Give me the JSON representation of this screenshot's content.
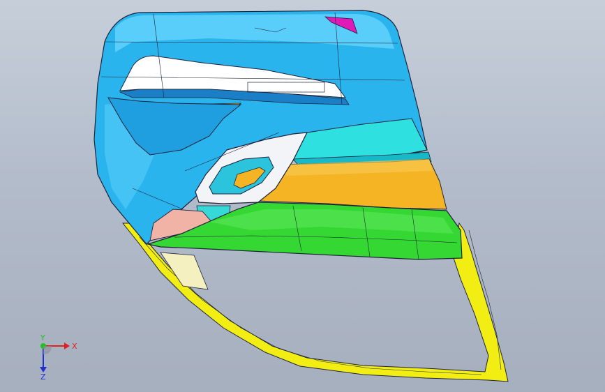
{
  "viewport": {
    "background_top": "#c6cfd9",
    "background_bottom": "#a6afbe"
  },
  "model": {
    "name": "door-trim-panel",
    "colors": {
      "upper_panel": "#2ab4ee",
      "upper_panel_light": "#6fd8ff",
      "window_opening": "#ffffff",
      "armrest_cyan": "#2fe0e0",
      "insert_orange": "#f5b424",
      "lower_green": "#35d832",
      "frame_yellow": "#f2ee14",
      "clip_magenta": "#e01ab8",
      "pocket_pink": "#f0b3a6",
      "edge_lines": "#1d2238"
    }
  },
  "triad": {
    "x_label": "X",
    "y_label": "Y",
    "z_label": "Z",
    "x_color": "#e02020",
    "y_color": "#20c020",
    "z_color": "#2030d0"
  }
}
